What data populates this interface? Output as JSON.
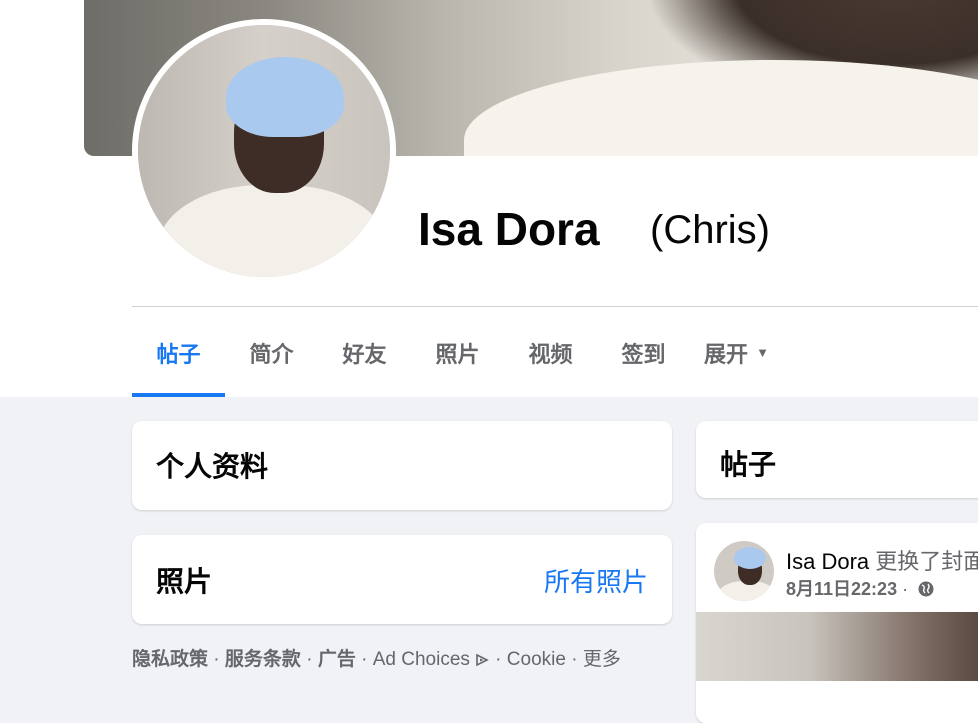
{
  "profile": {
    "name": "Isa Dora",
    "alternate_name": "(Chris)"
  },
  "tabs": [
    {
      "label": "帖子",
      "active": true
    },
    {
      "label": "简介"
    },
    {
      "label": "好友"
    },
    {
      "label": "照片"
    },
    {
      "label": "视频"
    },
    {
      "label": "签到"
    },
    {
      "label": "展开"
    }
  ],
  "intro_card": {
    "title": "个人资料"
  },
  "photos_card": {
    "title": "照片",
    "see_all": "所有照片"
  },
  "posts_card": {
    "title": "帖子"
  },
  "post": {
    "author": "Isa Dora",
    "action": "更换了封面",
    "timestamp": "8月11日22:23",
    "separator": "·"
  },
  "footer": {
    "items": [
      "隐私政策",
      "服务条款",
      "广告",
      "Ad Choices",
      "Cookie",
      "更多"
    ],
    "separator": " · "
  },
  "colors": {
    "accent": "#1877f2",
    "secondary_text": "#65676b",
    "background": "#f0f2f5"
  },
  "icons": {
    "tab_more": "caret-down-icon",
    "ad_choices": "ad-choices-icon",
    "audience": "globe-icon"
  }
}
